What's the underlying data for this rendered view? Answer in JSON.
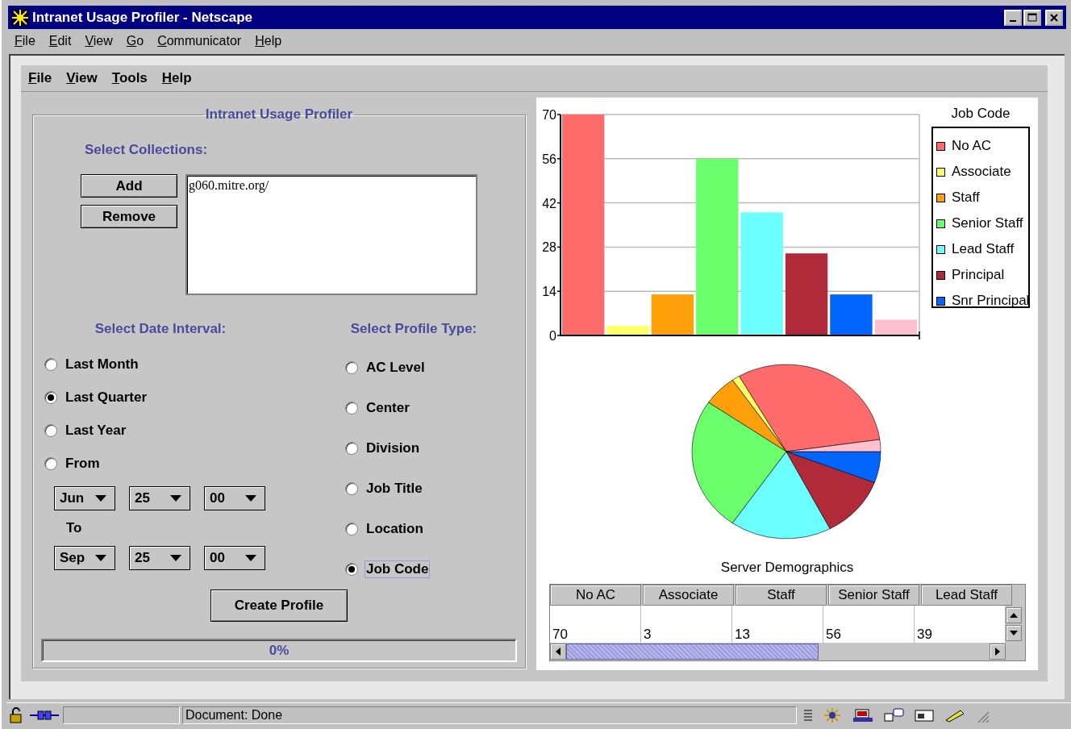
{
  "window": {
    "title": "Intranet Usage Profiler - Netscape"
  },
  "browser_menu": [
    "File",
    "Edit",
    "View",
    "Go",
    "Communicator",
    "Help"
  ],
  "app_menu": [
    "File",
    "View",
    "Tools",
    "Help"
  ],
  "panel": {
    "title": "Intranet Usage Profiler"
  },
  "collections": {
    "label": "Select Collections:",
    "buttons": [
      "Add",
      "Remove"
    ],
    "items": [
      "g060.mitre.org/"
    ]
  },
  "date_interval": {
    "label": "Select Date Interval:",
    "options": [
      {
        "label": "Last Month",
        "selected": false
      },
      {
        "label": "Last Quarter",
        "selected": true
      },
      {
        "label": "Last Year",
        "selected": false
      },
      {
        "label": "From",
        "selected": false
      }
    ],
    "from": [
      "Jun",
      "25",
      "00"
    ],
    "to_label": "To",
    "to": [
      "Sep",
      "25",
      "00"
    ]
  },
  "profile_type": {
    "label": "Select Profile Type:",
    "options": [
      {
        "label": "AC Level",
        "selected": false,
        "focused": false
      },
      {
        "label": "Center",
        "selected": false,
        "focused": false
      },
      {
        "label": "Division",
        "selected": false,
        "focused": false
      },
      {
        "label": "Job Title",
        "selected": false,
        "focused": false
      },
      {
        "label": "Location",
        "selected": false,
        "focused": false
      },
      {
        "label": "Job Code",
        "selected": true,
        "focused": true
      }
    ]
  },
  "create_button": "Create Profile",
  "progress": {
    "level": 0,
    "reading": "0%"
  },
  "chart": {
    "legend_title": "Job Code",
    "chart_data": {
      "type": "bar",
      "grid": true,
      "ylim": [
        0,
        70
      ],
      "yticks": [
        0,
        14,
        28,
        42,
        56,
        70
      ],
      "series": [
        {
          "name": "No AC",
          "color": "#ff6b6b",
          "values": [
            70
          ]
        },
        {
          "name": "Associate",
          "color": "#ffff66",
          "values": [
            3
          ]
        },
        {
          "name": "Staff",
          "color": "#ffa00a",
          "values": [
            13
          ]
        },
        {
          "name": "Senior Staff",
          "color": "#6bff6b",
          "values": [
            56
          ]
        },
        {
          "name": "Lead Staff",
          "color": "#6bffff",
          "values": [
            39
          ]
        },
        {
          "name": "Principal",
          "color": "#b02a3a",
          "values": [
            26
          ]
        },
        {
          "name": "Snr Principal",
          "color": "#0066ff",
          "values": [
            13
          ]
        },
        {
          "color": "#ffc0d0",
          "values": [
            5
          ]
        }
      ]
    }
  },
  "pie": {
    "caption": "Server Demographics"
  },
  "table": {
    "columns": [
      "No AC",
      "Associate",
      "Staff",
      "Senior Staff",
      "Lead Staff"
    ],
    "rows": [
      [
        "70",
        "3",
        "13",
        "56",
        "39"
      ]
    ]
  },
  "status_bar": {
    "text": "Document: Done"
  }
}
